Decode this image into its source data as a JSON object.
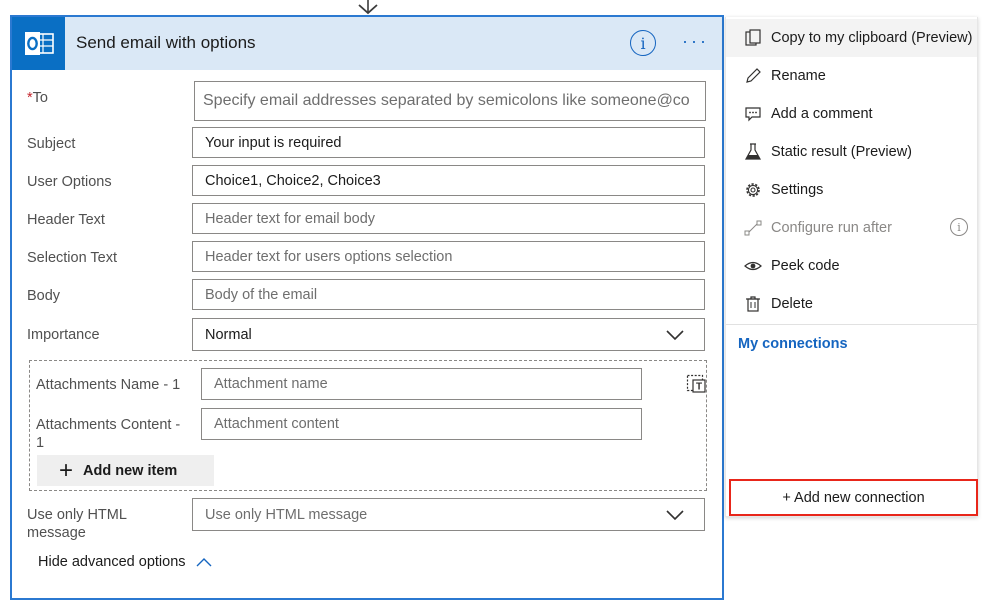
{
  "card": {
    "title": "Send email with options",
    "info_glyph": "i",
    "more_glyph": "···"
  },
  "form": {
    "to": {
      "required_mark": "*",
      "label": "To",
      "placeholder": "Specify email addresses separated by semicolons like someone@co"
    },
    "subject": {
      "label": "Subject",
      "value": "Your input is required"
    },
    "user_options": {
      "label": "User Options",
      "value": "Choice1, Choice2, Choice3"
    },
    "header_text": {
      "label": "Header Text",
      "placeholder": "Header text for email body"
    },
    "selection_text": {
      "label": "Selection Text",
      "placeholder": "Header text for users options selection"
    },
    "body": {
      "label": "Body",
      "placeholder": "Body of the email"
    },
    "importance": {
      "label": "Importance",
      "value": "Normal"
    },
    "attachments": {
      "name_label": "Attachments Name - 1",
      "name_placeholder": "Attachment name",
      "content_label_line1": "Attachments Content -",
      "content_label_line2": "1",
      "content_placeholder": "Attachment content",
      "add_item_label": "Add new item"
    },
    "use_only_html": {
      "label_line1": "Use only HTML",
      "label_line2": "message",
      "placeholder": "Use only HTML message"
    },
    "hide_advanced_label": "Hide advanced options"
  },
  "menu": {
    "items": [
      {
        "label": "Copy to my clipboard (Preview)",
        "icon": "clipboard-icon"
      },
      {
        "label": "Rename",
        "icon": "pencil-icon"
      },
      {
        "label": "Add a comment",
        "icon": "comment-icon"
      },
      {
        "label": "Static result (Preview)",
        "icon": "flask-icon"
      },
      {
        "label": "Settings",
        "icon": "gear-icon"
      },
      {
        "label": "Configure run after",
        "icon": "run-after-icon",
        "disabled": true
      },
      {
        "label": "Peek code",
        "icon": "eye-icon"
      },
      {
        "label": "Delete",
        "icon": "trash-icon"
      }
    ],
    "configure_info_glyph": "i",
    "my_connections_label": "My connections",
    "add_connection_label": "+ Add new connection"
  },
  "colors": {
    "accent": "#1565c0",
    "header_bg": "#dae8f6",
    "card_border": "#2b79d1",
    "highlight_border": "#e8261a",
    "required": "#c4262e"
  }
}
